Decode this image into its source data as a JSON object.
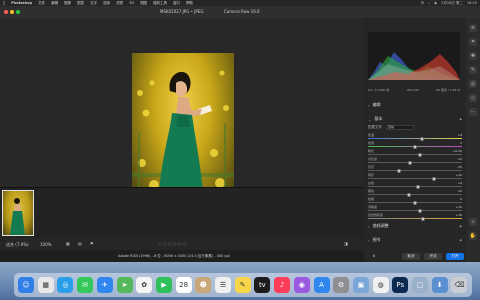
{
  "menubar": {
    "app_name": "Photoshop",
    "items": [
      "文件",
      "编辑",
      "图像",
      "图层",
      "文字",
      "选择",
      "滤镜",
      "3D",
      "视图",
      "增效工具",
      "窗口",
      "帮助"
    ],
    "status": [
      "中",
      "⌕",
      "◉",
      "2月18日 周二",
      "16:25"
    ]
  },
  "window": {
    "file_title": "MSK02027.JPG • JPEG",
    "app_title": "Camera Raw 16.0"
  },
  "bottombar": {
    "fit_label": "适合 (7.9%)",
    "zoom_label": "100%",
    "grid_icon": "grid-icon",
    "flag_icon": "flag-icon"
  },
  "histogram": {
    "info_left": "f/2 / 1/1000 秒",
    "info_mid": "ISO 100",
    "info_right": "85 毫米 / 2.95 M"
  },
  "panel": {
    "profile_label": "配置文件",
    "profile_value": "自动",
    "sections": {
      "edit": "编辑",
      "basic": "基本",
      "curve": "曲线调整",
      "detail": "细节"
    },
    "sliders": [
      {
        "label": "色温",
        "value": "+8",
        "pos": 0.58
      },
      {
        "label": "色调",
        "value": "0",
        "pos": 0.5
      },
      {
        "label": "曝光",
        "value": "+0.20",
        "pos": 0.55
      },
      {
        "label": "对比度",
        "value": "-12",
        "pos": 0.44
      },
      {
        "label": "高光",
        "value": "-35",
        "pos": 0.32
      },
      {
        "label": "阴影",
        "value": "+42",
        "pos": 0.71
      },
      {
        "label": "白色",
        "value": "+6",
        "pos": 0.53
      },
      {
        "label": "黑色",
        "value": "-15",
        "pos": 0.43
      },
      {
        "label": "纹理",
        "value": "0",
        "pos": 0.5
      },
      {
        "label": "清晰度",
        "value": "+10",
        "pos": 0.55
      },
      {
        "label": "自然饱和度",
        "value": "+18",
        "pos": 0.59
      }
    ]
  },
  "footer": {
    "cancel_label": "取消",
    "done_label": "完成",
    "open_label": "打开"
  },
  "status": {
    "text": "Adobe RGB (1998) - 8 位 - 6000 x 4000 (24.0 百万像素) - 300 ppi"
  },
  "dock": {
    "apps": [
      {
        "name": "finder-icon",
        "glyph": "☺",
        "color": "#2f7fe6"
      },
      {
        "name": "launchpad-icon",
        "glyph": "▦",
        "color": "#e8e8e8"
      },
      {
        "name": "safari-icon",
        "glyph": "◎",
        "color": "#2a9ee8"
      },
      {
        "name": "messages-icon",
        "glyph": "✉",
        "color": "#34c759"
      },
      {
        "name": "mail-icon",
        "glyph": "✈",
        "color": "#2f86ee"
      },
      {
        "name": "maps-icon",
        "glyph": "➤",
        "color": "#55b85a"
      },
      {
        "name": "photos-icon",
        "glyph": "✿",
        "color": "#f5f5f5"
      },
      {
        "name": "facetime-icon",
        "glyph": "▶",
        "color": "#2fbf5b"
      },
      {
        "name": "calendar-icon",
        "glyph": "28",
        "color": "#ffffff"
      },
      {
        "name": "contacts-icon",
        "glyph": "☻",
        "color": "#c8a878"
      },
      {
        "name": "reminders-icon",
        "glyph": "☰",
        "color": "#f0f0f0"
      },
      {
        "name": "notes-icon",
        "glyph": "✎",
        "color": "#f7d64a"
      },
      {
        "name": "appletv-icon",
        "glyph": "tv",
        "color": "#1c1c1c"
      },
      {
        "name": "music-icon",
        "glyph": "♪",
        "color": "#fa3c58"
      },
      {
        "name": "podcasts-icon",
        "glyph": "◉",
        "color": "#9b59e0"
      },
      {
        "name": "appstore-icon",
        "glyph": "A",
        "color": "#2f86ee"
      },
      {
        "name": "settings-icon",
        "glyph": "⚙",
        "color": "#8e8e93"
      },
      {
        "name": "preview-icon",
        "glyph": "▣",
        "color": "#7aa7d8"
      },
      {
        "name": "chrome-icon",
        "glyph": "◍",
        "color": "#f0f0f0"
      },
      {
        "name": "photoshop-icon",
        "glyph": "Ps",
        "color": "#0b2a4f"
      },
      {
        "name": "finder-extra-icon",
        "glyph": "▢",
        "color": "#9ab0c8"
      },
      {
        "name": "downloads-icon",
        "glyph": "⬇",
        "color": "#5b8fd0"
      },
      {
        "name": "trash-icon",
        "glyph": "⌫",
        "color": "#c9ccd2"
      }
    ]
  }
}
